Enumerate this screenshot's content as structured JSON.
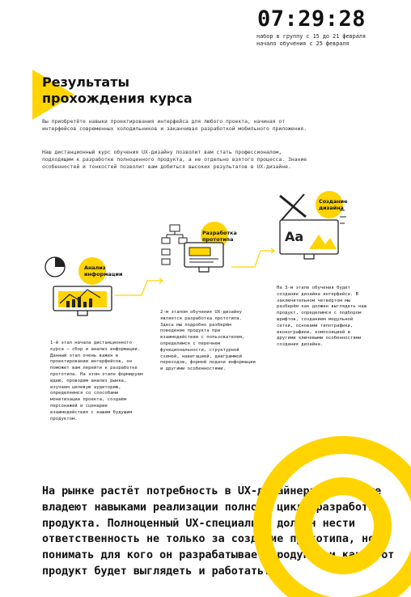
{
  "header": {
    "timer": "07:29:28",
    "enrollment": "набор в группу с 15 до 21 февраля",
    "start": "начало обучения с 25 февраля"
  },
  "intro": {
    "title_line1": "Результаты",
    "title_line2": "прохождения курса",
    "paragraph1": "Вы приобретёте навыки проектирования интерфейса для любого проекта, начиная от интерфейсов современных холодильников и заканчивая разработкой мобильного приложения.",
    "paragraph2": "Наш дистанционный курс обучения UX-дизайну позволит вам стать профессионалом, подходящим к разработке полноценного продукта, а не отдельно взятого процесса. Знание особенностей и тонкостей позволит вам добиться высоких результатов в UX-дизайне."
  },
  "stages": [
    {
      "label_line1": "Анализ",
      "label_line2": "информации",
      "text": "1-й этап начала дистанционного курса — сбор и анализ информации. Данный этап очень важен в проектировании интерфейсов, он поможет вам перейти к разработке прототипа. На этом этапе формируем идею, проводим анализ рынка, изучаем целевую аудиторию, определяемся со способами монетизации проекта, создаём персонажей и сценарии взаимодействия с нашим будущим продуктом."
    },
    {
      "label_line1": "Разработка",
      "label_line2": "прототипа",
      "text": "2-м этапом обучения UX-дизайну является разработка прототипа. Здесь мы подробно разберём поведение продукта при взаимодействии с пользователем, определимся с перечнем функциональности, структурной схемой, навигацией, диаграммой переходов, формой подачи информации и другими особенностями."
    },
    {
      "label_line1": "Создание",
      "label_line2": "дизайна",
      "text": "На 3-м этапе обучения будет создание дизайна интерфейса. В заключительном четвёртом мы разберём как должен выглядеть наш продукт, определимся с подбором шрифтов, созданием модульной сетки, основами типографики, иконографики, композицией и другими ключевыми особенностями создания дизайна."
    }
  ],
  "bottom_text": "На рынке растёт потребность в UX-дизайнерах, которые владеют навыками реализации полного цикла разработки продукта. Полноценный UX-специалист должен нести ответственность не только за создание прототипа, но и понимать для кого он разрабатывает продукт, и как этот продукт будет выглядеть и работать.",
  "colors": {
    "accent": "#ffd400",
    "text": "#111111"
  }
}
